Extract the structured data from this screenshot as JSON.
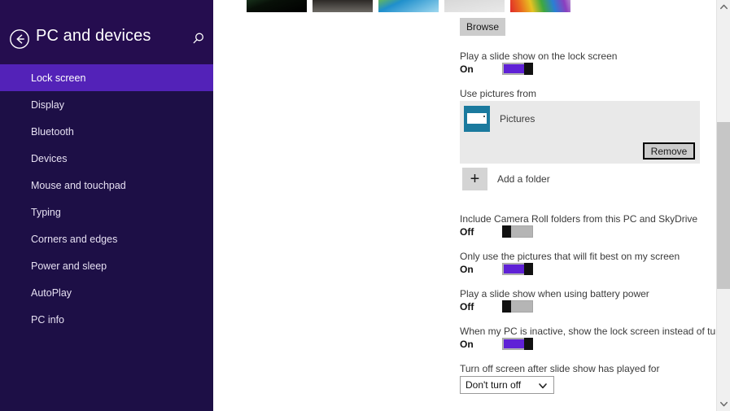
{
  "sidebar": {
    "back_icon": "back-arrow-circle-icon",
    "title": "PC and devices",
    "search_icon": "search-icon",
    "accent_selected": "#5322b8",
    "background": "#1d0f46",
    "items": [
      {
        "label": "Lock screen",
        "selected": true
      },
      {
        "label": "Display",
        "selected": false
      },
      {
        "label": "Bluetooth",
        "selected": false
      },
      {
        "label": "Devices",
        "selected": false
      },
      {
        "label": "Mouse and touchpad",
        "selected": false
      },
      {
        "label": "Typing",
        "selected": false
      },
      {
        "label": "Corners and edges",
        "selected": false
      },
      {
        "label": "Power and sleep",
        "selected": false
      },
      {
        "label": "AutoPlay",
        "selected": false
      },
      {
        "label": "PC info",
        "selected": false
      }
    ]
  },
  "content": {
    "thumbnails": [
      {
        "name": "lock-screen-thumbnail-1"
      },
      {
        "name": "lock-screen-thumbnail-2"
      },
      {
        "name": "lock-screen-thumbnail-3"
      },
      {
        "name": "lock-screen-thumbnail-4"
      },
      {
        "name": "lock-screen-thumbnail-5"
      }
    ],
    "browse_button": "Browse",
    "slideshow": {
      "label": "Play a slide show on the lock screen",
      "state": "On",
      "on": true
    },
    "use_pictures_from": {
      "label": "Use pictures from",
      "folders": [
        {
          "name": "Pictures",
          "icon": "pictures-folder-icon"
        }
      ],
      "remove_button": "Remove",
      "add_folder": "Add a folder",
      "add_folder_icon": "plus-icon"
    },
    "camera_roll": {
      "label": "Include Camera Roll folders from this PC and SkyDrive",
      "state": "Off",
      "on": false
    },
    "fit_best": {
      "label": "Only use the pictures that will fit best on my screen",
      "state": "On",
      "on": true
    },
    "battery_power": {
      "label": "Play a slide show when using battery power",
      "state": "Off",
      "on": false
    },
    "inactive_lock": {
      "label": "When my PC is inactive, show the lock screen instead of turning off the screen",
      "state": "On",
      "on": true
    },
    "turn_off_screen": {
      "label": "Turn off screen after slide show has played for",
      "value": "Don't turn off",
      "chevron_icon": "chevron-down-icon"
    }
  },
  "scrollbar": {
    "up_icon": "scroll-up-arrow-icon",
    "down_icon": "scroll-down-arrow-icon",
    "thumb_name": "scrollbar-thumb"
  }
}
